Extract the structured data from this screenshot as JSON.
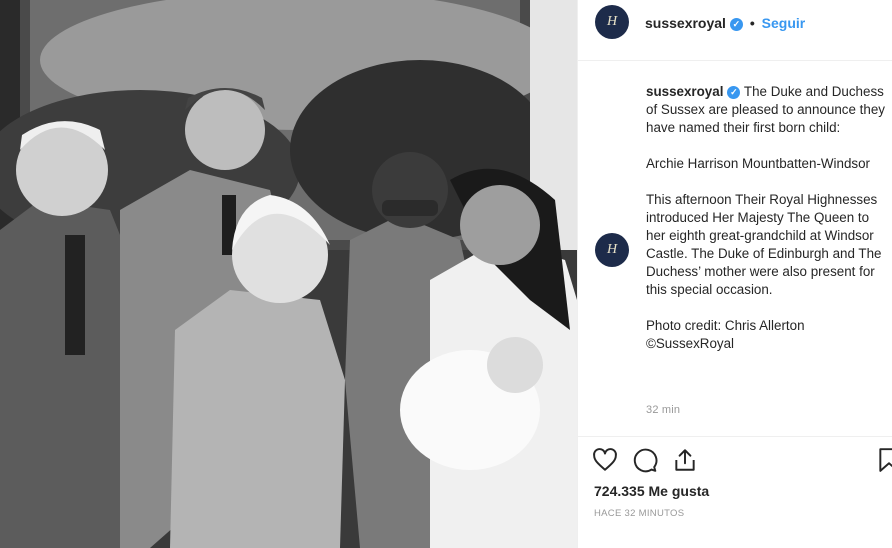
{
  "post": {
    "username": "sussexroyal",
    "follow_label": "Seguir",
    "separator": "•",
    "avatar_letter": "H",
    "caption_user": "sussexroyal",
    "caption_paragraphs": [
      "The Duke and Duchess of Sussex are pleased to announce they have named their first born child:",
      "Archie Harrison Mountbatten-Windsor",
      "This afternoon Their Royal Highnesses introduced Her Majesty The Queen to her eighth great-grandchild at Windsor Castle. The Duke of Edinburgh and The Duchess’ mother were also present for this special occasion.",
      "Photo credit: Chris Allerton\n©SussexRoyal"
    ],
    "comment_time": "32 min",
    "likes": "724.335 Me gusta",
    "posted_ago": "HACE 32 MINUTOS"
  },
  "colors": {
    "accent": "#3897f0",
    "avatar_bg": "#1d2b4a",
    "text": "#262626",
    "muted": "#999999"
  },
  "icons": [
    "heart-icon",
    "comment-icon",
    "share-icon",
    "bookmark-icon",
    "verified-badge-icon"
  ]
}
